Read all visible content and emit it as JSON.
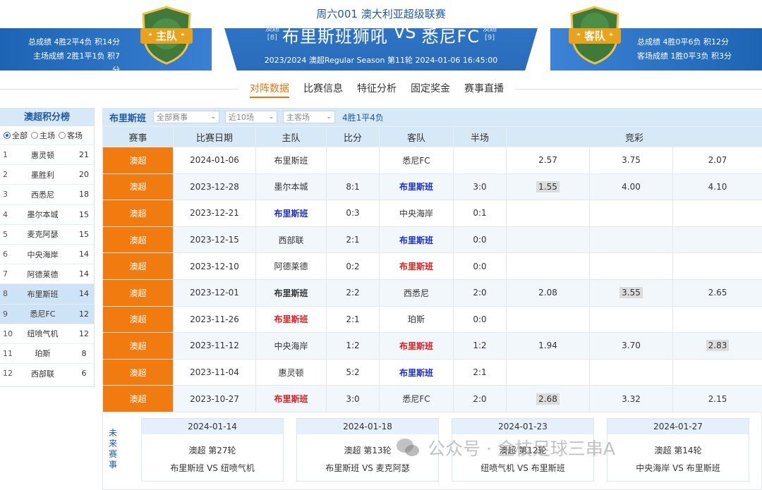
{
  "header": {
    "league_title": "周六001 澳大利亚超级联赛",
    "home_team": "布里斯班狮吼",
    "away_team": "悉尼FC",
    "vs": "VS",
    "home_rank_league": "澳超",
    "home_rank_pos": "[8]",
    "away_rank_league": "澳超",
    "away_rank_pos": "[9]",
    "season_line": "2023/2024 澳超Regular Season 第11轮  2024-01-06  16:45:00",
    "home_badge": "主队",
    "away_badge": "客队",
    "home_overall": "总成绩 4胜2平4负 积14分",
    "home_home": "主场成绩 2胜1平1负 积7分",
    "away_overall": "总成绩 4胜0平6负 积12分",
    "away_away": "客场成绩 1胜0平3负 积3分",
    "home_badge_color": "#3f7a3a",
    "away_badge_color": "#3f7a3a",
    "accent_color": "#e8a21c"
  },
  "nav": {
    "items": [
      "对阵数据",
      "比赛信息",
      "特征分析",
      "固定奖金",
      "赛事直播"
    ],
    "active": "对阵数据"
  },
  "standings": {
    "title": "澳超积分榜",
    "filters": [
      "全部",
      "主场",
      "客场"
    ],
    "selected_filter": "全部",
    "rows": [
      {
        "rank": "1",
        "team": "惠灵顿",
        "pts": "21"
      },
      {
        "rank": "2",
        "team": "墨胜利",
        "pts": "20"
      },
      {
        "rank": "3",
        "team": "西悉尼",
        "pts": "18"
      },
      {
        "rank": "4",
        "team": "墨尔本城",
        "pts": "15"
      },
      {
        "rank": "5",
        "team": "麦克阿瑟",
        "pts": "15"
      },
      {
        "rank": "6",
        "team": "中央海岸",
        "pts": "14"
      },
      {
        "rank": "7",
        "team": "阿德莱德",
        "pts": "14"
      },
      {
        "rank": "8",
        "team": "布里斯班",
        "pts": "14"
      },
      {
        "rank": "9",
        "team": "悉尼FC",
        "pts": "12"
      },
      {
        "rank": "10",
        "team": "纽喷气机",
        "pts": "12"
      },
      {
        "rank": "11",
        "team": "珀斯",
        "pts": "8"
      },
      {
        "rank": "12",
        "team": "西部联",
        "pts": "6"
      }
    ]
  },
  "filter_bar": {
    "team": "布里斯班",
    "competition": "全部赛事",
    "range": "近10场",
    "venue": "主客场",
    "record": "4胜1平4负"
  },
  "table": {
    "headers": [
      "赛事",
      "比赛日期",
      "主队",
      "比分",
      "客队",
      "半场",
      "竞彩"
    ],
    "rows": [
      {
        "league": "澳超",
        "date": "2024-01-06",
        "home": "布里斯班",
        "home_style": "",
        "score": "",
        "away": "悉尼FC",
        "away_style": "",
        "half": "",
        "o1": "2.57",
        "o2": "3.75",
        "o3": "2.07",
        "hl": ""
      },
      {
        "league": "澳超",
        "date": "2023-12-28",
        "home": "墨尔本城",
        "home_style": "",
        "score": "8:1",
        "away": "布里斯班",
        "away_style": "blue",
        "half": "3:0",
        "o1": "1.55",
        "o2": "4.00",
        "o3": "4.10",
        "hl": "o1"
      },
      {
        "league": "澳超",
        "date": "2023-12-21",
        "home": "布里斯班",
        "home_style": "blue",
        "score": "0:3",
        "away": "中央海岸",
        "away_style": "",
        "half": "0:1",
        "o1": "",
        "o2": "",
        "o3": "",
        "hl": ""
      },
      {
        "league": "澳超",
        "date": "2023-12-15",
        "home": "西部联",
        "home_style": "",
        "score": "2:1",
        "away": "布里斯班",
        "away_style": "blue",
        "half": "0:0",
        "o1": "",
        "o2": "",
        "o3": "",
        "hl": ""
      },
      {
        "league": "澳超",
        "date": "2023-12-10",
        "home": "阿德莱德",
        "home_style": "",
        "score": "0:2",
        "away": "布里斯班",
        "away_style": "red",
        "half": "0:0",
        "o1": "",
        "o2": "",
        "o3": "",
        "hl": ""
      },
      {
        "league": "澳超",
        "date": "2023-12-01",
        "home": "布里斯班",
        "home_style": "dark",
        "score": "2:2",
        "away": "西悉尼",
        "away_style": "",
        "half": "2:0",
        "o1": "2.08",
        "o2": "3.55",
        "o3": "2.65",
        "hl": "o2"
      },
      {
        "league": "澳超",
        "date": "2023-11-26",
        "home": "布里斯班",
        "home_style": "red",
        "score": "2:1",
        "away": "珀斯",
        "away_style": "",
        "half": "0:0",
        "o1": "",
        "o2": "",
        "o3": "",
        "hl": ""
      },
      {
        "league": "澳超",
        "date": "2023-11-12",
        "home": "中央海岸",
        "home_style": "",
        "score": "1:2",
        "away": "布里斯班",
        "away_style": "red",
        "half": "1:2",
        "o1": "1.94",
        "o2": "3.70",
        "o3": "2.83",
        "hl": "o3"
      },
      {
        "league": "澳超",
        "date": "2023-11-04",
        "home": "惠灵顿",
        "home_style": "",
        "score": "5:2",
        "away": "布里斯班",
        "away_style": "blue",
        "half": "2:1",
        "o1": "",
        "o2": "",
        "o3": "",
        "hl": ""
      },
      {
        "league": "澳超",
        "date": "2023-10-27",
        "home": "布里斯班",
        "home_style": "red",
        "score": "3:0",
        "away": "悉尼FC",
        "away_style": "",
        "half": "2:0",
        "o1": "2.68",
        "o2": "3.32",
        "o3": "2.15",
        "hl": "o1"
      }
    ]
  },
  "future": {
    "label": "未来赛事",
    "cards": [
      {
        "date": "2024-01-14",
        "round": "澳超 第27轮",
        "match": "布里斯班 VS 纽喷气机"
      },
      {
        "date": "2024-01-18",
        "round": "澳超 第13轮",
        "match": "布里斯班 VS 麦克阿瑟"
      },
      {
        "date": "2024-01-23",
        "round": "澳超 第12轮",
        "match": "纽喷气机 VS 布里斯班"
      },
      {
        "date": "2024-01-27",
        "round": "澳超 第14轮",
        "match": "中央海岸 VS 布里斯班"
      }
    ]
  },
  "watermark": "公众号 · 金枝足球三串A"
}
